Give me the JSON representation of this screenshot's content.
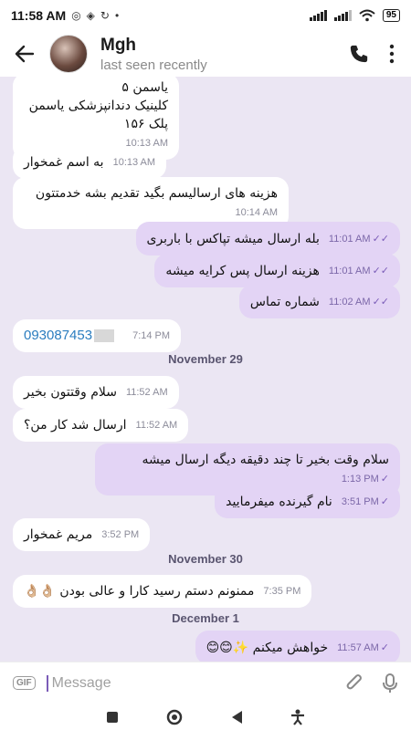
{
  "status_bar": {
    "time": "11:58 AM",
    "battery": "95"
  },
  "header": {
    "contact_name": "Mgh",
    "contact_status": "last seen recently"
  },
  "messages": [
    {
      "dir": "in",
      "text_lines": [
        "یاسمن ۵",
        "کلینیک دندانپزشکی یاسمن",
        "پلک ۱۵۶"
      ],
      "time": "10:13 AM"
    },
    {
      "dir": "in",
      "text": "به اسم غمخوار",
      "time": "10:13 AM"
    },
    {
      "dir": "in",
      "text": "هزینه های ارسالیسم بگید تقدیم بشه خدمتتون",
      "time": "10:14 AM"
    },
    {
      "dir": "out",
      "text": "بله ارسال میشه تپاکس با باربری",
      "time": "11:01 AM"
    },
    {
      "dir": "out",
      "text": "هزینه ارسال پس کرایه میشه",
      "time": "11:01 AM"
    },
    {
      "dir": "out",
      "text": "شماره تماس",
      "time": "11:02 AM"
    },
    {
      "dir": "in",
      "text": "093087453",
      "time": "7:14 PM"
    },
    {
      "dir": "in",
      "text": "سلام وقتتون بخیر",
      "time": "11:52 AM"
    },
    {
      "dir": "in",
      "text": "ارسال شد کار من؟",
      "time": "11:52 AM"
    },
    {
      "dir": "out",
      "text": "سلام وقت بخیر تا چند دقیقه دیگه ارسال میشه",
      "time": "1:13 PM"
    },
    {
      "dir": "out",
      "text": "نام گیرنده میفرمایید",
      "time": "3:51 PM"
    },
    {
      "dir": "in",
      "text": "مریم غمخوار",
      "time": "3:52 PM"
    },
    {
      "dir": "in",
      "text": "ممنونم دستم رسید کارا و عالی بودن",
      "emoji": "👌🏼👌🏼",
      "time": "7:35 PM"
    },
    {
      "dir": "out",
      "text": "خواهش میکنم",
      "emoji": "😊😊✨",
      "time": "11:57 AM"
    }
  ],
  "dates": [
    "November 29",
    "November 30",
    "December 1"
  ],
  "composer": {
    "gif_label": "GIF",
    "placeholder": "Message"
  }
}
